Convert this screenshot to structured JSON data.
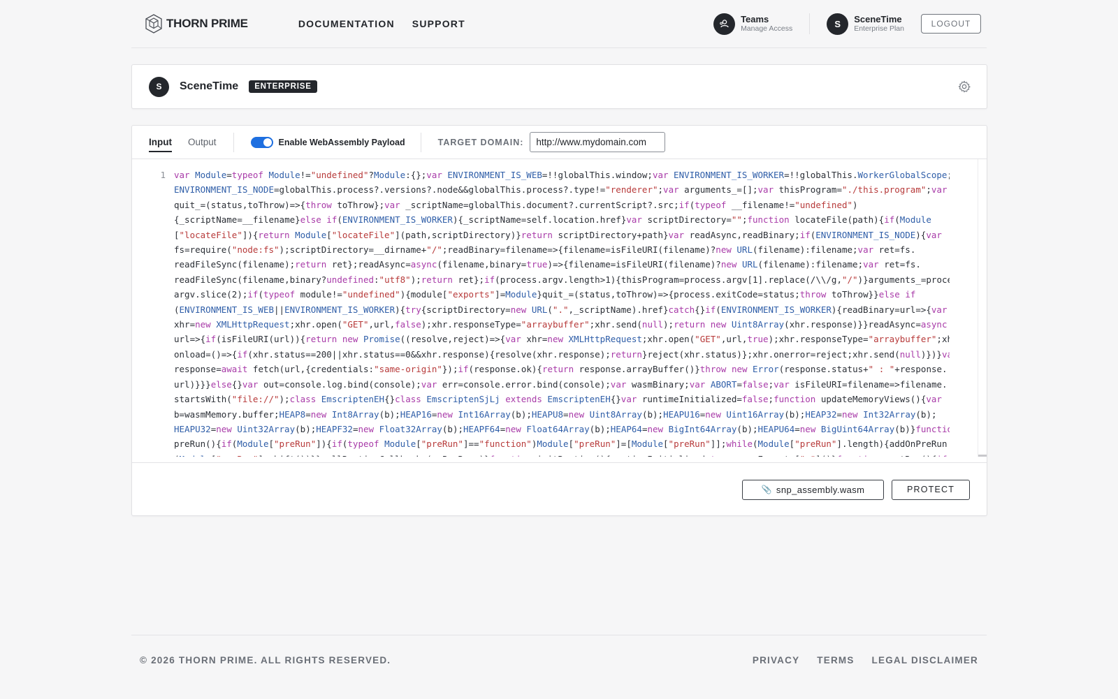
{
  "brand": {
    "name": "THORN PRIME",
    "logo_icon": "hexagon-cube-icon"
  },
  "nav": {
    "documentation": "DOCUMENTATION",
    "support": "SUPPORT"
  },
  "header": {
    "teams": {
      "title": "Teams",
      "subtitle": "Manage Access",
      "icon": "user-group-icon"
    },
    "account": {
      "initial": "S",
      "title": "SceneTime",
      "subtitle": "Enterprise Plan"
    },
    "logout": "LOGOUT"
  },
  "project": {
    "initial": "S",
    "name": "SceneTime",
    "badge": "ENTERPRISE",
    "settings_icon": "gear-icon"
  },
  "editor": {
    "tabs": [
      {
        "label": "Input",
        "active": true
      },
      {
        "label": "Output",
        "active": false
      }
    ],
    "toggle_label": "Enable WebAssembly Payload",
    "toggle_on": true,
    "domain_label": "TARGET DOMAIN:",
    "domain_value": "http://www.mydomain.com",
    "line_numbers": [
      "1"
    ],
    "code_lines": [
      "var Module=typeof Module!=\"undefined\"?Module:{};var ENVIRONMENT_IS_WEB=!!globalThis.window;var ENVIRONMENT_IS_WORKER=!!globalThis.WorkerGlobalScope;var",
      "ENVIRONMENT_IS_NODE=globalThis.process?.versions?.node&&globalThis.process?.type!=\"renderer\";var arguments_=[];var thisProgram=\"./this.program\";var",
      "quit_=(status,toThrow)=>{throw toThrow};var _scriptName=globalThis.document?.currentScript?.src;if(typeof __filename!=\"undefined\")",
      "{_scriptName=__filename}else if(ENVIRONMENT_IS_WORKER){_scriptName=self.location.href}var scriptDirectory=\"\";function locateFile(path){if(Module",
      "[\"locateFile\"]){return Module[\"locateFile\"](path,scriptDirectory)}return scriptDirectory+path}var readAsync,readBinary;if(ENVIRONMENT_IS_NODE){var",
      "fs=require(\"node:fs\");scriptDirectory=__dirname+\"/\";readBinary=filename=>{filename=isFileURI(filename)?new URL(filename):filename;var ret=fs.",
      "readFileSync(filename);return ret};readAsync=async(filename,binary=true)=>{filename=isFileURI(filename)?new URL(filename):filename;var ret=fs.",
      "readFileSync(filename,binary?undefined:\"utf8\");return ret};if(process.argv.length>1){thisProgram=process.argv[1].replace(/\\\\/g,\"/\")}arguments_=process.",
      "argv.slice(2);if(typeof module!=\"undefined\"){module[\"exports\"]=Module}quit_=(status,toThrow)=>{process.exitCode=status;throw toThrow}}else if",
      "(ENVIRONMENT_IS_WEB||ENVIRONMENT_IS_WORKER){try{scriptDirectory=new URL(\".\",_scriptName).href}catch{}if(ENVIRONMENT_IS_WORKER){readBinary=url=>{var",
      "xhr=new XMLHttpRequest;xhr.open(\"GET\",url,false);xhr.responseType=\"arraybuffer\";xhr.send(null);return new Uint8Array(xhr.response)}}readAsync=async",
      "url=>{if(isFileURI(url)){return new Promise((resolve,reject)=>{var xhr=new XMLHttpRequest;xhr.open(\"GET\",url,true);xhr.responseType=\"arraybuffer\";xhr.",
      "onload=()=>{if(xhr.status==200||xhr.status==0&&xhr.response){resolve(xhr.response);return}reject(xhr.status)};xhr.onerror=reject;xhr.send(null)})}var",
      "response=await fetch(url,{credentials:\"same-origin\"});if(response.ok){return response.arrayBuffer()}throw new Error(response.status+\" : \"+response.",
      "url)}}}else{}var out=console.log.bind(console);var err=console.error.bind(console);var wasmBinary;var ABORT=false;var isFileURI=filename=>filename.",
      "startsWith(\"file://\");class EmscriptenEH{}class EmscriptenSjLj extends EmscriptenEH{}var runtimeInitialized=false;function updateMemoryViews(){var",
      "b=wasmMemory.buffer;HEAP8=new Int8Array(b);HEAP16=new Int16Array(b);HEAPU8=new Uint8Array(b);HEAPU16=new Uint16Array(b);HEAP32=new Int32Array(b);",
      "HEAPU32=new Uint32Array(b);HEAPF32=new Float32Array(b);HEAPF64=new Float64Array(b);HEAP64=new BigInt64Array(b);HEAPU64=new BigUint64Array(b)}function",
      "preRun(){if(Module[\"preRun\"]){if(typeof Module[\"preRun\"]==\"function\")Module[\"preRun\"]=[Module[\"preRun\"]];while(Module[\"preRun\"].length){addOnPreRun",
      "(Module[\"preRun\"].shift())}}callRuntimeCallbacks(onPreRuns)}function initRuntime(){runtimeInitialized=true;wasmExports[\"c\"]()}function postRun(){if"
    ],
    "file_button": "snp_assembly.wasm",
    "file_icon": "paperclip-icon",
    "protect_button": "PROTECT"
  },
  "footer": {
    "copyright": "© 2026 THORN PRIME. ALL RIGHTS RESERVED.",
    "links": [
      "PRIVACY",
      "TERMS",
      "LEGAL DISCLAIMER"
    ]
  },
  "colors": {
    "accent": "#1e6fe0",
    "dark": "#24272c",
    "background": "#f6f6f7"
  }
}
